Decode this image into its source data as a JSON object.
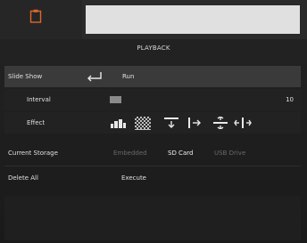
{
  "header": {
    "icon": "clipboard-icon",
    "accent_color": "#e0672a"
  },
  "title": "PLAYBACK",
  "rows": {
    "slideshow": {
      "label": "Slide Show",
      "action": "Run",
      "icon": "enter-icon"
    },
    "interval": {
      "label": "Interval",
      "value": "10"
    },
    "effect": {
      "label": "Effect",
      "icons": [
        "effect-blocks-icon",
        "effect-dissolve-icon",
        "effect-wipe-down-icon",
        "effect-wipe-right-icon",
        "effect-split-vertical-icon",
        "effect-split-horizontal-icon"
      ]
    },
    "storage": {
      "label": "Current Storage",
      "options": [
        "Embedded",
        "SD Card",
        "USB Drive"
      ],
      "selected": "SD Card"
    },
    "delete": {
      "label": "Delete All",
      "action": "Execute"
    }
  }
}
